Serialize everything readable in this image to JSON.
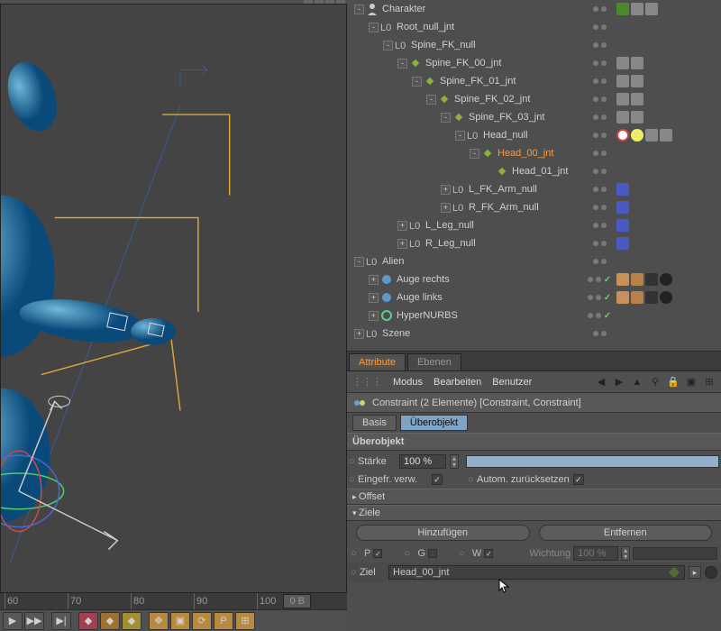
{
  "hierarchy": [
    {
      "indent": 0,
      "exp": "-",
      "icon": "person",
      "name": "Charakter",
      "tags": [
        "green-figure",
        "po",
        "ps"
      ]
    },
    {
      "indent": 1,
      "exp": "-",
      "icon": "null",
      "name": "Root_null_jnt"
    },
    {
      "indent": 2,
      "exp": "-",
      "icon": "null",
      "name": "Spine_FK_null"
    },
    {
      "indent": 3,
      "exp": "-",
      "icon": "joint",
      "name": "Spine_FK_00_jnt",
      "tags": [
        "po",
        "ps"
      ]
    },
    {
      "indent": 4,
      "exp": "-",
      "icon": "joint",
      "name": "Spine_FK_01_jnt",
      "tags": [
        "po",
        "ps"
      ]
    },
    {
      "indent": 5,
      "exp": "-",
      "icon": "joint",
      "name": "Spine_FK_02_jnt",
      "tags": [
        "po",
        "ps"
      ]
    },
    {
      "indent": 6,
      "exp": "-",
      "icon": "joint",
      "name": "Spine_FK_03_jnt",
      "tags": [
        "po",
        "ps"
      ]
    },
    {
      "indent": 7,
      "exp": "-",
      "icon": "null",
      "name": "Head_null",
      "tags": [
        "forbid",
        "bulb",
        "po",
        "ps"
      ]
    },
    {
      "indent": 8,
      "exp": "-",
      "icon": "joint",
      "name": "Head_00_jnt",
      "sel": true
    },
    {
      "indent": 9,
      "exp": "",
      "icon": "joint",
      "name": "Head_01_jnt"
    },
    {
      "indent": 6,
      "exp": "+",
      "icon": "null",
      "name": "L_FK_Arm_null",
      "tags": [
        "blue-red"
      ]
    },
    {
      "indent": 6,
      "exp": "+",
      "icon": "null",
      "name": "R_FK_Arm_null",
      "tags": [
        "blue-red"
      ]
    },
    {
      "indent": 3,
      "exp": "+",
      "icon": "null",
      "name": "L_Leg_null",
      "tags": [
        "blue-red"
      ]
    },
    {
      "indent": 3,
      "exp": "+",
      "icon": "null",
      "name": "R_Leg_null",
      "tags": [
        "blue-red"
      ]
    },
    {
      "indent": 0,
      "exp": "-",
      "icon": "null",
      "name": "Alien"
    },
    {
      "indent": 1,
      "exp": "+",
      "icon": "sphere",
      "name": "Auge rechts",
      "check": true,
      "tags": [
        "tex",
        "tex2",
        "noise",
        "ball"
      ]
    },
    {
      "indent": 1,
      "exp": "+",
      "icon": "sphere",
      "name": "Auge links",
      "check": true,
      "tags": [
        "tex",
        "tex2",
        "noise",
        "ball"
      ]
    },
    {
      "indent": 1,
      "exp": "+",
      "icon": "hnurbs",
      "name": "HyperNURBS",
      "check": true
    },
    {
      "indent": 0,
      "exp": "+",
      "icon": "null",
      "name": "Szene"
    }
  ],
  "attribute": {
    "tabs": {
      "attribute": "Attribute",
      "ebenen": "Ebenen"
    },
    "menu": {
      "modus": "Modus",
      "bearbeiten": "Bearbeiten",
      "benutzer": "Benutzer"
    },
    "header": "Constraint (2 Elemente) [Constraint, Constraint]",
    "subtabs": {
      "basis": "Basis",
      "uberobjekt": "Überobjekt"
    },
    "section_title": "Überobjekt",
    "starke_label": "Stärke",
    "starke_value": "100 %",
    "eingefr_label": "Eingefr. verw.",
    "autom_label": "Autom. zurücksetzen",
    "offset": "Offset",
    "ziele": "Ziele",
    "hinzufugen": "Hinzufügen",
    "entfernen": "Entfernen",
    "p": "P",
    "g": "G",
    "w": "W",
    "wichtung_label": "Wichtung",
    "wichtung_value": "100 %",
    "ziel_label": "Ziel",
    "ziel_value": "Head_00_jnt"
  },
  "timeline": {
    "ticks": [
      60,
      70,
      80,
      90,
      100
    ],
    "scrub": "0 B"
  }
}
